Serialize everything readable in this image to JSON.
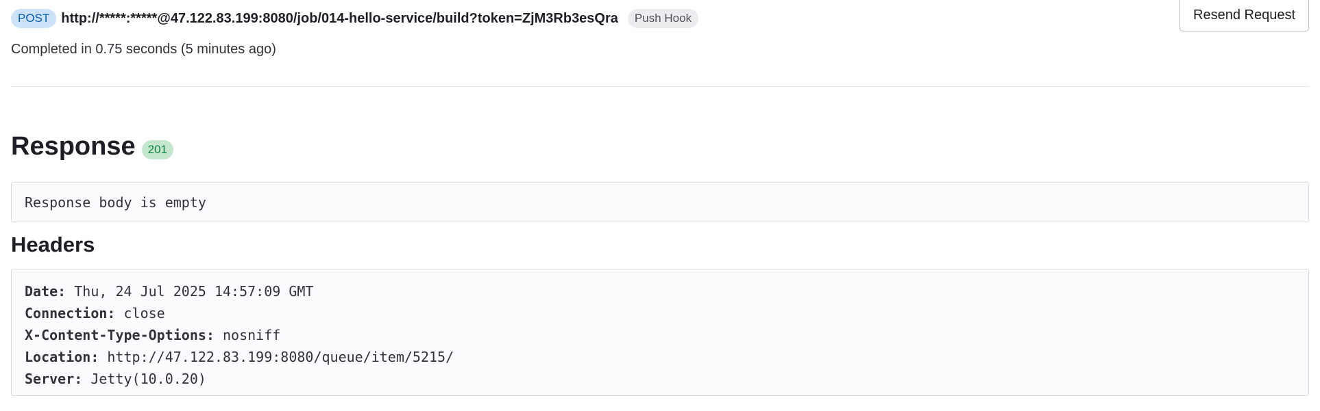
{
  "request": {
    "method": "POST",
    "url": "http://*****:*****@47.122.83.199:8080/job/014-hello-service/build?token=ZjM3Rb3esQra",
    "trigger": "Push Hook",
    "completed": "Completed in 0.75 seconds (5 minutes ago)",
    "resend_label": "Resend Request"
  },
  "response": {
    "title": "Response",
    "status": "201",
    "body": "Response body is empty"
  },
  "headers": {
    "title": "Headers",
    "items": [
      {
        "key": "Date:",
        "value": " Thu, 24 Jul 2025 14:57:09 GMT"
      },
      {
        "key": "Connection:",
        "value": " close"
      },
      {
        "key": "X-Content-Type-Options:",
        "value": " nosniff"
      },
      {
        "key": "Location:",
        "value": " http://47.122.83.199:8080/queue/item/5215/"
      },
      {
        "key": "Server:",
        "value": " Jetty(10.0.20)"
      }
    ]
  },
  "colors": {
    "method_badge_bg": "#cbe2f9",
    "method_badge_text": "#0b5cad",
    "status_badge_bg": "#c3e6cd",
    "status_badge_text": "#108548",
    "trigger_badge_bg": "#ececef"
  }
}
